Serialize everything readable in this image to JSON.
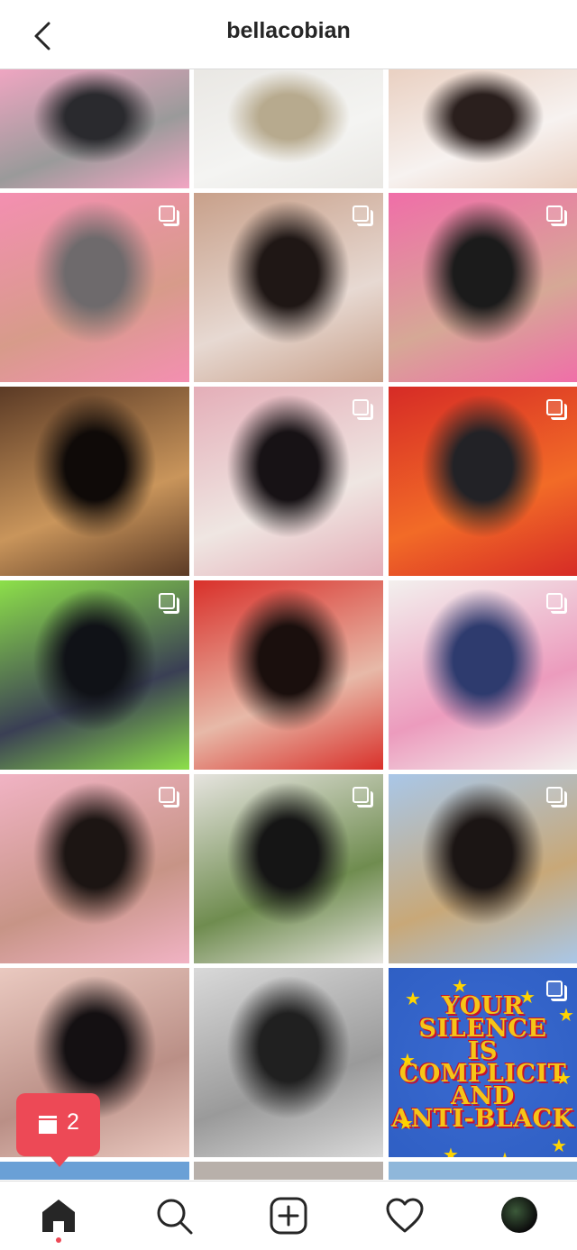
{
  "header": {
    "title": "bellacobian",
    "back_icon": "chevron-left-icon"
  },
  "posts": [
    {
      "id": "p1",
      "multi": false,
      "colors": [
        "#f2a6c3",
        "#2a2a2e",
        "#9a9a9a"
      ]
    },
    {
      "id": "p2",
      "multi": false,
      "colors": [
        "#e9e7e3",
        "#b7aa8e",
        "#f4f4f2"
      ]
    },
    {
      "id": "p3",
      "multi": false,
      "colors": [
        "#e9cfc0",
        "#2a1f1d",
        "#f7f2f0"
      ]
    },
    {
      "id": "p4",
      "multi": true,
      "colors": [
        "#f48fb1",
        "#6e6a6c",
        "#d79b8a"
      ]
    },
    {
      "id": "p5",
      "multi": true,
      "colors": [
        "#c8a08a",
        "#1f1715",
        "#e7d9d2"
      ]
    },
    {
      "id": "p6",
      "multi": true,
      "colors": [
        "#f06ea8",
        "#1b1b1b",
        "#d6a896"
      ]
    },
    {
      "id": "p7",
      "multi": false,
      "colors": [
        "#5b3a25",
        "#0f0a08",
        "#c9955b"
      ]
    },
    {
      "id": "p8",
      "multi": true,
      "colors": [
        "#e4aeb8",
        "#171215",
        "#efe6e2"
      ]
    },
    {
      "id": "p9",
      "multi": true,
      "colors": [
        "#d62b26",
        "#222226",
        "#f26b27"
      ]
    },
    {
      "id": "p10",
      "multi": true,
      "colors": [
        "#8de04a",
        "#101217",
        "#3a3f54"
      ]
    },
    {
      "id": "p11",
      "multi": false,
      "colors": [
        "#d9302a",
        "#1a0f0d",
        "#e7b9a8"
      ]
    },
    {
      "id": "p12",
      "multi": true,
      "colors": [
        "#f3f0ee",
        "#2e3b6e",
        "#ec9bbd"
      ]
    },
    {
      "id": "p13",
      "multi": true,
      "colors": [
        "#f1b3c4",
        "#1c1513",
        "#c79486"
      ]
    },
    {
      "id": "p14",
      "multi": true,
      "colors": [
        "#e6e4df",
        "#151515",
        "#6f8c4f"
      ]
    },
    {
      "id": "p15",
      "multi": true,
      "colors": [
        "#a9c7e8",
        "#1b1514",
        "#c8a878"
      ]
    },
    {
      "id": "p16",
      "multi": false,
      "colors": [
        "#eac9c0",
        "#141012",
        "#ba8f86"
      ]
    },
    {
      "id": "p17",
      "multi": false,
      "colors": [
        "#d9d9d9",
        "#202020",
        "#9a9a9a"
      ]
    },
    {
      "id": "p18",
      "multi": true,
      "poster": true,
      "colors": [
        "#2f5fc4",
        "#2a55b8",
        "#3a6ad0"
      ]
    }
  ],
  "poster_lines": [
    "YOUR",
    "SILENCE",
    "IS",
    "COMPLICIT",
    "AND",
    "ANTI-BLACK"
  ],
  "toast": {
    "count": "2",
    "icon": "posts-stack-icon"
  },
  "nav": {
    "home_icon": "home-icon",
    "search_icon": "search-icon",
    "new_post_icon": "add-post-icon",
    "activity_icon": "heart-icon",
    "profile_icon": "profile-avatar"
  },
  "colors": {
    "accent": "#ed4956",
    "text": "#262626",
    "border": "#dbdbdb"
  }
}
